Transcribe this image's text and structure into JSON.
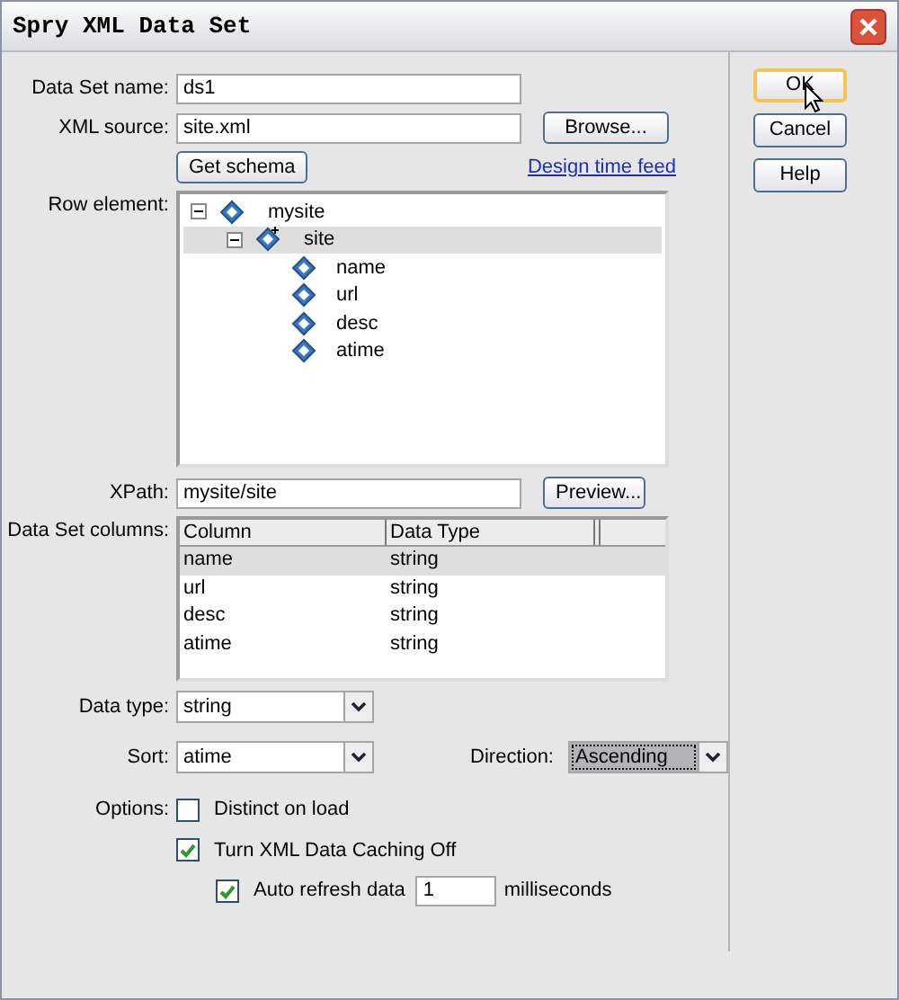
{
  "window": {
    "title": "Spry XML Data Set"
  },
  "fields": {
    "name_label": "Data Set name:",
    "name_value": "ds1",
    "source_label": "XML source:",
    "source_value": "site.xml",
    "browse": "Browse...",
    "get_schema": "Get schema",
    "design_link": "Design time feed"
  },
  "row_element": {
    "label": "Row element:",
    "tree": [
      {
        "label": "mysite",
        "expanded": true,
        "selected": false,
        "children": [
          {
            "label": "site",
            "expanded": true,
            "selected": true,
            "children": [
              {
                "label": "name",
                "selected": false
              },
              {
                "label": "url",
                "selected": false
              },
              {
                "label": "desc",
                "selected": false
              },
              {
                "label": "atime",
                "selected": false
              }
            ]
          }
        ]
      }
    ]
  },
  "xpath": {
    "label": "XPath:",
    "value": "mysite/site",
    "button": "Preview..."
  },
  "columns_table": {
    "label": "Data Set columns:",
    "columns": [
      "Column",
      "Data Type"
    ],
    "rows": [
      {
        "cells": [
          "name",
          "string"
        ],
        "selected": true
      },
      {
        "cells": [
          "url",
          "string"
        ],
        "selected": false
      },
      {
        "cells": [
          "desc",
          "string"
        ],
        "selected": false
      },
      {
        "cells": [
          "atime",
          "string"
        ],
        "selected": false
      }
    ]
  },
  "data_type": {
    "label": "Data type:",
    "value": "string"
  },
  "sort": {
    "label": "Sort:",
    "value": "atime",
    "direction_label": "Direction:",
    "direction_value": "Ascending",
    "direction_focused": true
  },
  "options": {
    "label": "Options:",
    "items": [
      {
        "label": "Distinct on load",
        "checked": false
      },
      {
        "label": "Turn XML Data Caching Off",
        "checked": true,
        "children": [
          {
            "label": "Auto refresh data",
            "checked": true,
            "value": "1",
            "suffix": "milliseconds"
          }
        ]
      }
    ]
  },
  "buttons": [
    {
      "label": "OK",
      "focused": true
    },
    {
      "label": "Cancel",
      "focused": false
    },
    {
      "label": "Help",
      "focused": false
    }
  ]
}
